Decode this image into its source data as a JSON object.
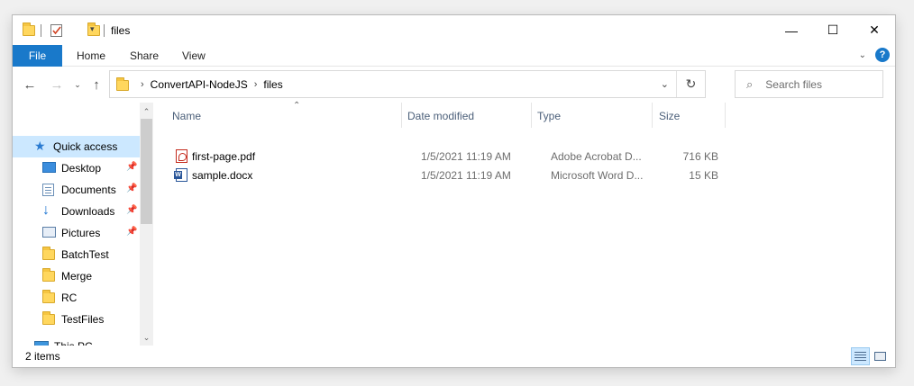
{
  "window": {
    "title": "files",
    "controls": {
      "minimize": "—",
      "maximize": "☐",
      "close": "✕"
    }
  },
  "ribbon": {
    "file_tab": "File",
    "tabs": [
      "Home",
      "Share",
      "View"
    ]
  },
  "address": {
    "crumbs": [
      "ConvertAPI-NodeJS",
      "files"
    ]
  },
  "search": {
    "placeholder": "Search files"
  },
  "nav": {
    "quick_access": "Quick access",
    "items": [
      {
        "label": "Desktop",
        "icon": "desktop-icon",
        "pinned": true
      },
      {
        "label": "Documents",
        "icon": "documents-icon",
        "pinned": true
      },
      {
        "label": "Downloads",
        "icon": "downloads-icon",
        "pinned": true
      },
      {
        "label": "Pictures",
        "icon": "pictures-icon",
        "pinned": true
      },
      {
        "label": "BatchTest",
        "icon": "folder-icon",
        "pinned": false
      },
      {
        "label": "Merge",
        "icon": "folder-icon",
        "pinned": false
      },
      {
        "label": "RC",
        "icon": "folder-icon",
        "pinned": false
      },
      {
        "label": "TestFiles",
        "icon": "folder-icon",
        "pinned": false
      }
    ],
    "this_pc": "This PC"
  },
  "columns": {
    "name": "Name",
    "date": "Date modified",
    "type": "Type",
    "size": "Size"
  },
  "files": [
    {
      "name": "first-page.pdf",
      "date": "1/5/2021 11:19 AM",
      "type": "Adobe Acrobat D...",
      "size": "716 KB",
      "icon": "pdf-icon"
    },
    {
      "name": "sample.docx",
      "date": "1/5/2021 11:19 AM",
      "type": "Microsoft Word D...",
      "size": "15 KB",
      "icon": "word-icon"
    }
  ],
  "status": {
    "item_count": "2 items"
  },
  "colors": {
    "accent": "#1979ca",
    "selection": "#cce8ff"
  }
}
